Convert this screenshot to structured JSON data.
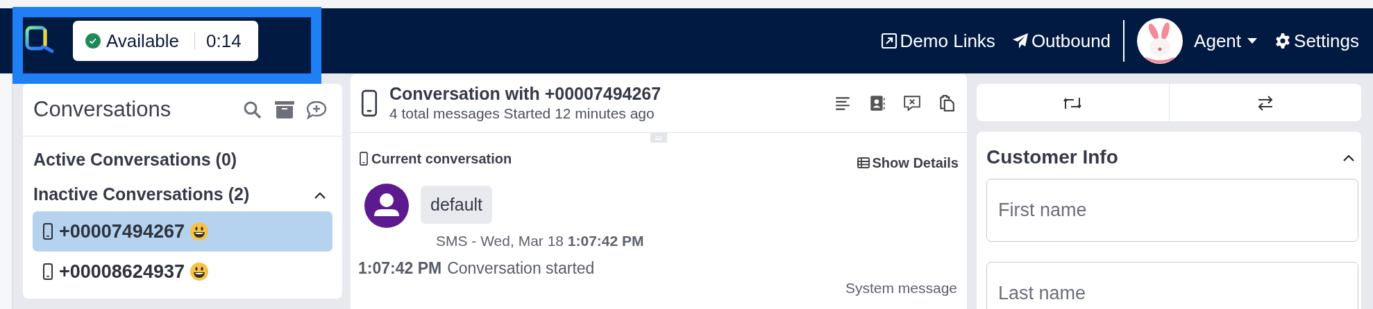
{
  "navbar": {
    "highlighted": true,
    "status": {
      "label": "Available",
      "timer": "0:14",
      "available": true
    },
    "links": [
      {
        "label": "Demo Links",
        "kind": "external"
      },
      {
        "label": "Outbound",
        "kind": "send"
      }
    ],
    "user": {
      "label": "Agent"
    },
    "settings": {
      "label": "Settings"
    }
  },
  "conversations": {
    "title": "Conversations",
    "groups": [
      {
        "label": "Active Conversations (0)",
        "expanded": false
      },
      {
        "label": "Inactive Conversations (2)",
        "expanded": true,
        "items": [
          {
            "number": "+00007494267",
            "selected": true
          },
          {
            "number": "+00008624937",
            "selected": false
          }
        ]
      }
    ]
  },
  "conversation": {
    "title": "Conversation with +00007494267",
    "subtitle": "4 total messages Started 12 minutes ago",
    "section_label": "Current conversation",
    "details_button": "Show Details",
    "messages": [
      {
        "kind": "bubble",
        "text": "default",
        "meta": "SMS - Wed, Mar 18 **1:07:42 PM**"
      },
      {
        "kind": "event",
        "time": "1:07:42 PM",
        "text": "Conversation started",
        "source": "System message"
      }
    ]
  },
  "customer_info": {
    "title": "Customer Info",
    "expanded": true,
    "fields": [
      {
        "placeholder": "First name"
      },
      {
        "placeholder": "Last name"
      }
    ]
  }
}
